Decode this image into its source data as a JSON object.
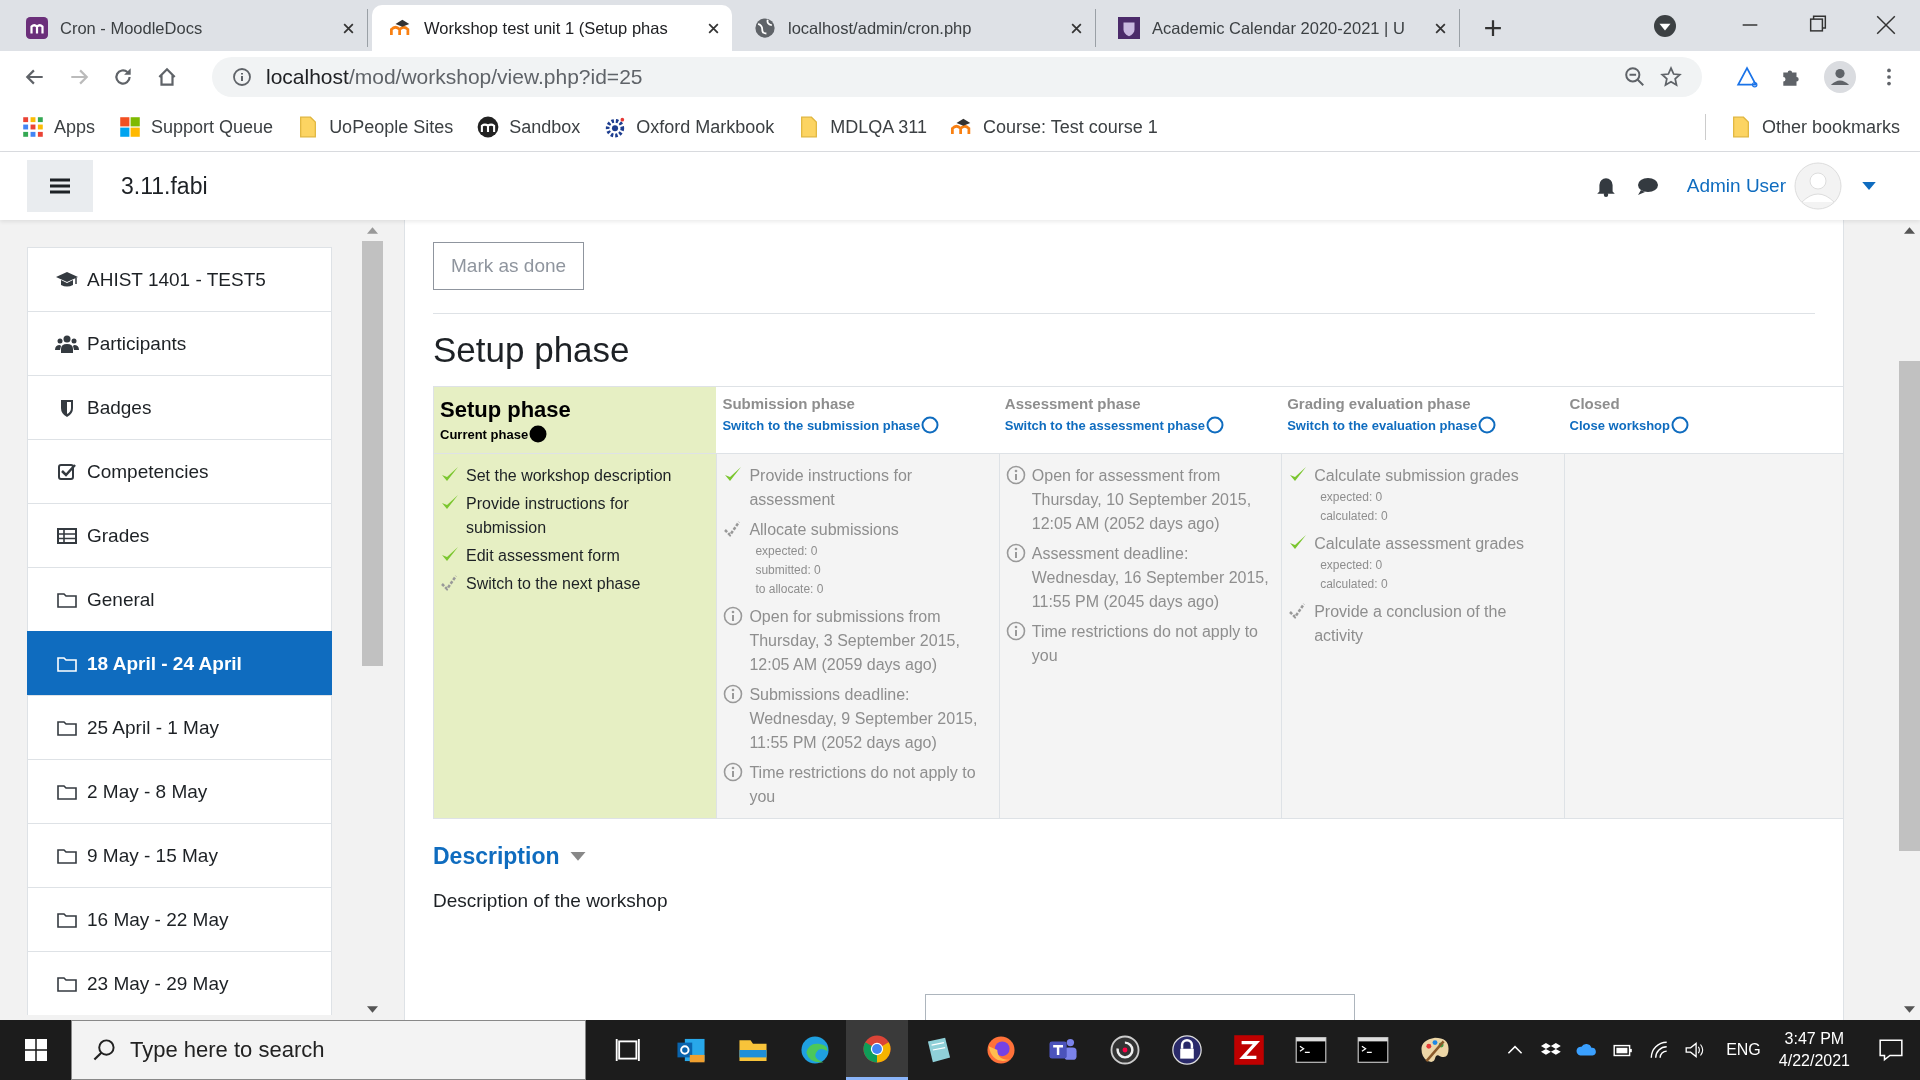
{
  "browser": {
    "tabs": [
      {
        "title": "Cron - MoodleDocs",
        "kind": "docs",
        "selected": false
      },
      {
        "title": "Workshop test unit 1 (Setup phas",
        "kind": "hat",
        "selected": true
      },
      {
        "title": "localhost/admin/cron.php",
        "kind": "globe",
        "selected": false
      },
      {
        "title": "Academic Calendar 2020-2021 | U",
        "kind": "shield",
        "selected": false
      }
    ],
    "address": {
      "host": "localhost",
      "path": "/mod/workshop/view.php?id=25"
    },
    "bookmarks": [
      {
        "label": "Apps",
        "kind": "apps"
      },
      {
        "label": "Support Queue",
        "kind": "windows"
      },
      {
        "label": "UoPeople Sites",
        "kind": "folder"
      },
      {
        "label": "Sandbox",
        "kind": "moodle"
      },
      {
        "label": "Oxford Markbook",
        "kind": "gear"
      },
      {
        "label": "MDLQA 311",
        "kind": "folder"
      },
      {
        "label": "Course: Test course 1",
        "kind": "hat"
      }
    ],
    "other_bookmarks": "Other bookmarks"
  },
  "navbar": {
    "site_name": "3.11.fabi",
    "user_name": "Admin User"
  },
  "sidebar": {
    "items": [
      {
        "label": "AHIST 1401 - TEST5",
        "kind": "course",
        "selected": false
      },
      {
        "label": "Participants",
        "kind": "users",
        "selected": false
      },
      {
        "label": "Badges",
        "kind": "badge",
        "selected": false
      },
      {
        "label": "Competencies",
        "kind": "check",
        "selected": false
      },
      {
        "label": "Grades",
        "kind": "table",
        "selected": false
      },
      {
        "label": "General",
        "kind": "folder",
        "selected": false
      },
      {
        "label": "18 April - 24 April",
        "kind": "folder",
        "selected": true
      },
      {
        "label": "25 April - 1 May",
        "kind": "folder",
        "selected": false
      },
      {
        "label": "2 May - 8 May",
        "kind": "folder",
        "selected": false
      },
      {
        "label": "9 May - 15 May",
        "kind": "folder",
        "selected": false
      },
      {
        "label": "16 May - 22 May",
        "kind": "folder",
        "selected": false
      },
      {
        "label": "23 May - 29 May",
        "kind": "folder",
        "selected": false
      }
    ]
  },
  "main": {
    "mark_button": "Mark as done",
    "heading": "Setup phase",
    "phases": [
      {
        "title": "Setup phase",
        "selected": true,
        "link": "Current phase",
        "tasks": [
          {
            "kind": "done",
            "text": "Set the workshop description"
          },
          {
            "kind": "done",
            "text": "Provide instructions for submission"
          },
          {
            "kind": "done",
            "text": "Edit assessment form"
          },
          {
            "kind": "todo",
            "text": "Switch to the next phase"
          }
        ]
      },
      {
        "title": "Submission phase",
        "selected": false,
        "link": "Switch to the submission phase",
        "tasks": [
          {
            "kind": "done",
            "text": "Provide instructions for assessment"
          },
          {
            "kind": "todo",
            "text": "Allocate submissions",
            "details": [
              "expected: 0",
              "submitted: 0",
              "to allocate: 0"
            ]
          },
          {
            "kind": "info",
            "text": "Open for submissions from Thursday, 3 September 2015, 12:05 AM (2059 days ago)"
          },
          {
            "kind": "info",
            "text": "Submissions deadline: Wednesday, 9 September 2015, 11:55 PM (2052 days ago)"
          },
          {
            "kind": "info",
            "text": "Time restrictions do not apply to you"
          }
        ]
      },
      {
        "title": "Assessment phase",
        "selected": false,
        "link": "Switch to the assessment phase",
        "tasks": [
          {
            "kind": "info",
            "text": "Open for assessment from Thursday, 10 September 2015, 12:05 AM (2052 days ago)"
          },
          {
            "kind": "info",
            "text": "Assessment deadline: Wednesday, 16 September 2015, 11:55 PM (2045 days ago)"
          },
          {
            "kind": "info",
            "text": "Time restrictions do not apply to you"
          }
        ]
      },
      {
        "title": "Grading evaluation phase",
        "selected": false,
        "link": "Switch to the evaluation phase",
        "tasks": [
          {
            "kind": "done",
            "text": "Calculate submission grades",
            "details": [
              "expected: 0",
              "calculated: 0"
            ]
          },
          {
            "kind": "done",
            "text": "Calculate assessment grades",
            "details": [
              "expected: 0",
              "calculated: 0"
            ]
          },
          {
            "kind": "todo",
            "text": "Provide a conclusion of the activity"
          }
        ]
      },
      {
        "title": "Closed",
        "selected": false,
        "link": "Close workshop"
      }
    ],
    "description_heading": "Description",
    "description": "Description of the workshop"
  },
  "taskbar": {
    "search": {
      "placeholder": "Type here to search"
    },
    "apps": [
      {
        "kind": "taskview",
        "selected": false
      },
      {
        "kind": "mail",
        "selected": false
      },
      {
        "kind": "files",
        "selected": false
      },
      {
        "kind": "edge",
        "selected": false
      },
      {
        "kind": "chrome",
        "selected": true
      },
      {
        "kind": "notes",
        "selected": false
      },
      {
        "kind": "firefox",
        "selected": false
      },
      {
        "kind": "teams",
        "selected": false
      },
      {
        "kind": "disc",
        "selected": false
      },
      {
        "kind": "lock",
        "selected": false
      },
      {
        "kind": "ftp",
        "selected": false
      },
      {
        "kind": "terminal",
        "selected": false
      },
      {
        "kind": "terminal",
        "selected": false
      },
      {
        "kind": "paint",
        "selected": false
      }
    ],
    "language": "ENG",
    "time": "3:47 PM",
    "date": "4/22/2021"
  }
}
